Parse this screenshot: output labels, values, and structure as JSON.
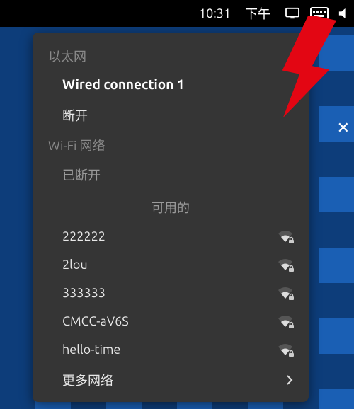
{
  "topbar": {
    "time": "10:31",
    "ampm": "下午"
  },
  "panel": {
    "ethernet": {
      "title": "以太网",
      "active_connection": "Wired connection 1",
      "disconnect": "断开"
    },
    "wifi": {
      "title": "Wi-Fi 网络",
      "status": "已断开",
      "available_label": "可用的",
      "networks": [
        {
          "ssid": "222222",
          "strength": 2,
          "secured": true
        },
        {
          "ssid": "2lou",
          "strength": 2,
          "secured": true
        },
        {
          "ssid": "333333",
          "strength": 2,
          "secured": true
        },
        {
          "ssid": "CMCC-aV6S",
          "strength": 2,
          "secured": true
        },
        {
          "ssid": "hello-time",
          "strength": 2,
          "secured": true
        }
      ],
      "more": "更多网络"
    }
  },
  "close_label": "✕"
}
